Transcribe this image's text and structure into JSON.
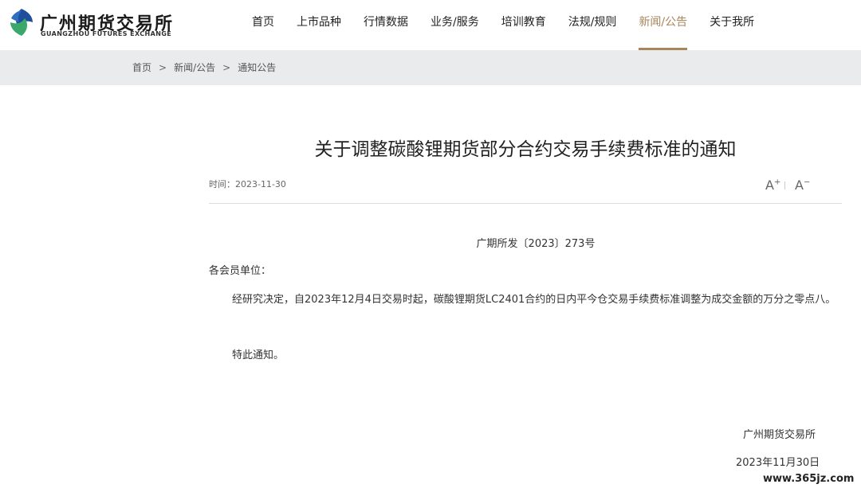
{
  "logo": {
    "cn": "广州期货交易所",
    "en": "GUANGZHOU FUTURES EXCHANGE"
  },
  "nav": [
    {
      "label": "首页",
      "active": false
    },
    {
      "label": "上市品种",
      "active": false
    },
    {
      "label": "行情数据",
      "active": false
    },
    {
      "label": "业务/服务",
      "active": false
    },
    {
      "label": "培训教育",
      "active": false
    },
    {
      "label": "法规/规则",
      "active": false
    },
    {
      "label": "新闻/公告",
      "active": true
    },
    {
      "label": "关于我所",
      "active": false
    }
  ],
  "breadcrumb": {
    "home": "首页",
    "section": "新闻/公告",
    "current": "通知公告",
    "separator": ">"
  },
  "article": {
    "title": "关于调整碳酸锂期货部分合约交易手续费标准的通知",
    "date_label": "时间：2023-11-30",
    "font_increase": "A",
    "font_decrease": "A",
    "doc_number": "广期所发〔2023〕273号",
    "salutation": "各会员单位：",
    "body": "经研究决定，自2023年12月4日交易时起，碳酸锂期货LC2401合约的日内平今仓交易手续费标准调整为成交金额的万分之零点八。",
    "closing": "特此通知。",
    "signature_org": "广州期货交易所",
    "signature_date": "2023年11月30日"
  },
  "watermark": "www.365jz.com",
  "colors": {
    "accent": "#a8865c",
    "crumb_bg": "#eaebec",
    "logo_blue": "#1f4e9c",
    "logo_green": "#3aa86b"
  }
}
